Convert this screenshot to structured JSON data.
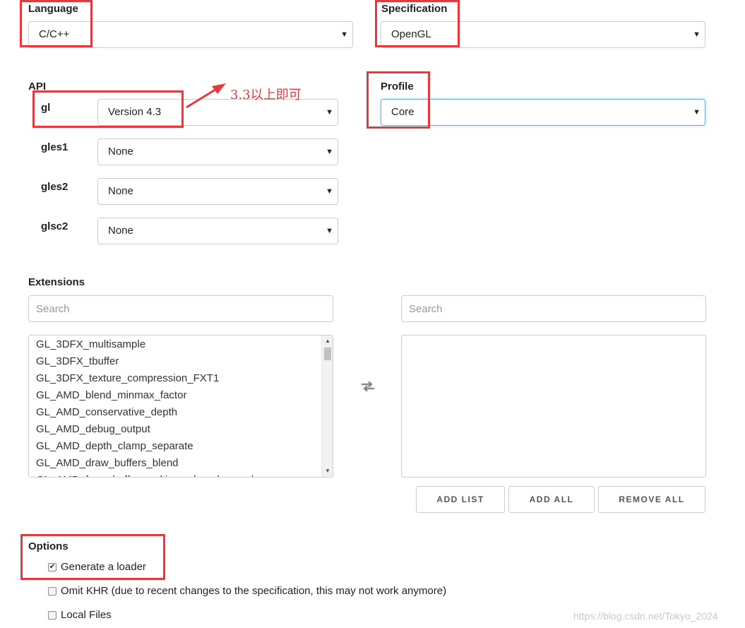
{
  "language": {
    "label": "Language",
    "selected": "C/C++"
  },
  "specification": {
    "label": "Specification",
    "selected": "OpenGL"
  },
  "api": {
    "label": "API",
    "rows": [
      {
        "name": "gl",
        "selected": "Version 4.3"
      },
      {
        "name": "gles1",
        "selected": "None"
      },
      {
        "name": "gles2",
        "selected": "None"
      },
      {
        "name": "glsc2",
        "selected": "None"
      }
    ]
  },
  "profile": {
    "label": "Profile",
    "selected": "Core"
  },
  "annotation": {
    "text": "3.3以上即可"
  },
  "extensions": {
    "label": "Extensions",
    "left_search_placeholder": "Search",
    "right_search_placeholder": "Search",
    "available": [
      "GL_3DFX_multisample",
      "GL_3DFX_tbuffer",
      "GL_3DFX_texture_compression_FXT1",
      "GL_AMD_blend_minmax_factor",
      "GL_AMD_conservative_depth",
      "GL_AMD_debug_output",
      "GL_AMD_depth_clamp_separate",
      "GL_AMD_draw_buffers_blend",
      "GL_AMD_framebuffer_multisample_advanced"
    ],
    "swap_icon": "swap-arrows-icon",
    "buttons": {
      "add_list": "ADD LIST",
      "add_all": "ADD ALL",
      "remove_all": "REMOVE ALL"
    }
  },
  "options": {
    "label": "Options",
    "items": [
      {
        "label": "Generate a loader",
        "checked": true
      },
      {
        "label": "Omit KHR (due to recent changes to the specification, this may not work anymore)",
        "checked": false
      },
      {
        "label": "Local Files",
        "checked": false
      }
    ]
  },
  "watermark": "https://blog.csdn.net/Tokyo_2024",
  "colors": {
    "annotation_red": "#e8383d",
    "focus_blue": "#66afe9"
  }
}
